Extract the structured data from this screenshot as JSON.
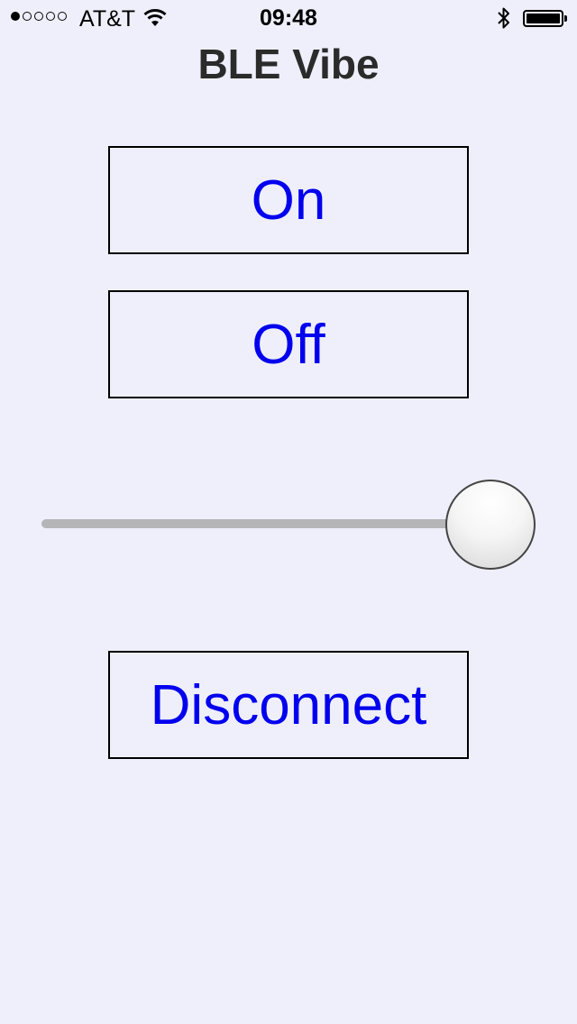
{
  "status_bar": {
    "carrier": "AT&T",
    "time": "09:48",
    "signal_bars_filled": 1,
    "signal_bars_total": 5,
    "battery_level": 1.0
  },
  "title": "BLE Vibe",
  "buttons": {
    "on_label": "On",
    "off_label": "Off",
    "disconnect_label": "Disconnect"
  },
  "slider": {
    "value": 1.0
  },
  "colors": {
    "background": "#efeffb",
    "button_text": "#0000ee",
    "title_text": "#2b2b2b"
  },
  "icons": [
    "signal-dots-icon",
    "wifi-icon",
    "bluetooth-icon",
    "battery-icon"
  ]
}
